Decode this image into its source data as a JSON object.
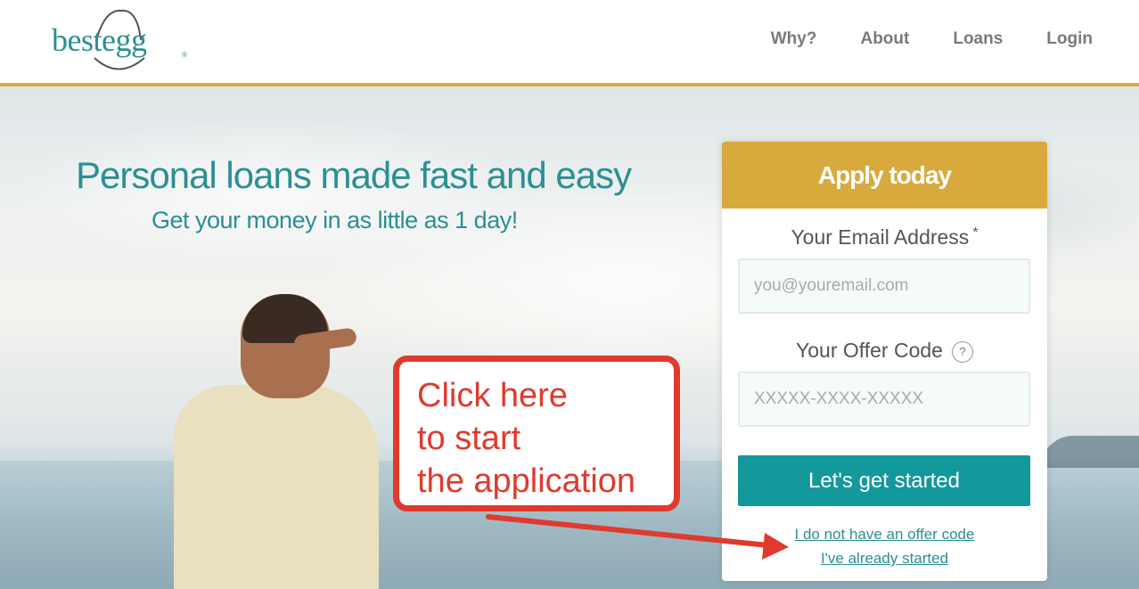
{
  "header": {
    "logo": "bestegg",
    "logo_reg": "®",
    "nav": [
      "Why?",
      "About",
      "Loans",
      "Login"
    ]
  },
  "hero": {
    "title": "Personal loans made fast and easy",
    "subtitle": "Get your money in as little as 1 day!"
  },
  "apply_card": {
    "title": "Apply today",
    "email_label": "Your Email Address",
    "email_required": "*",
    "email_placeholder": "you@youremail.com",
    "offer_label": "Your Offer Code",
    "offer_help": "?",
    "offer_placeholder": "XXXXX-XXXX-XXXXX",
    "submit": "Let's get started",
    "no_offer_link": "I do not have an offer code",
    "started_link": "I've already started"
  },
  "annotation": {
    "lines": [
      "Click here",
      "to start",
      "the application"
    ]
  },
  "colors": {
    "teal": "#2b8f93",
    "gold": "#d8a93d",
    "button": "#13989c",
    "annotation": "#e03a2e"
  }
}
